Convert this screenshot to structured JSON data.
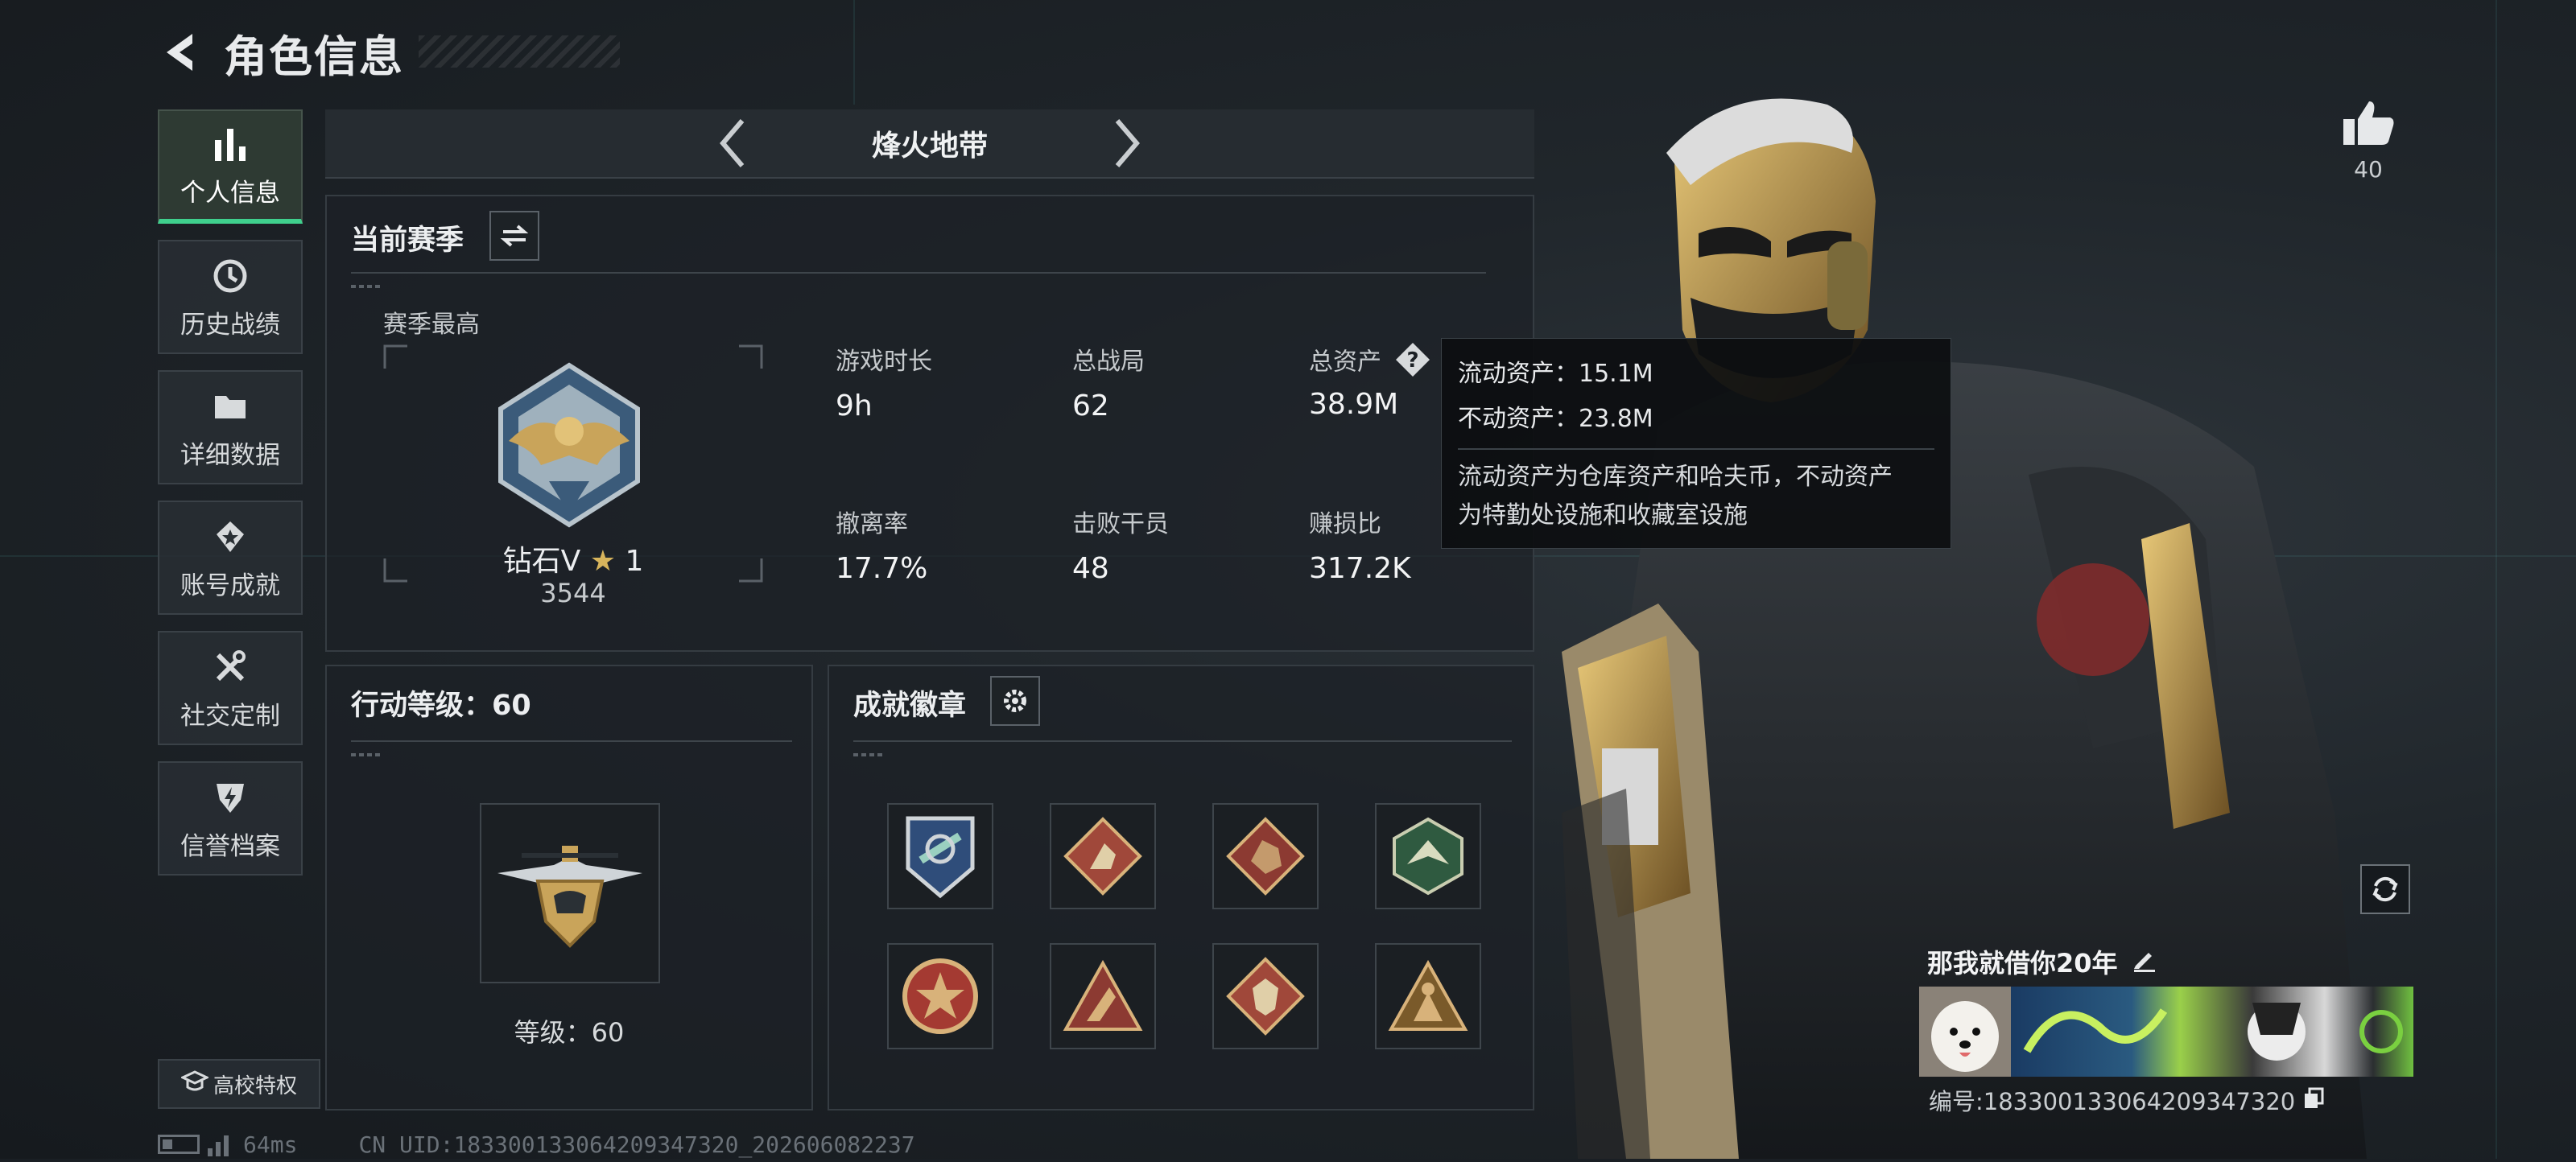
{
  "header": {
    "title": "角色信息"
  },
  "sidebar": {
    "items": [
      {
        "label": "个人信息"
      },
      {
        "label": "历史战绩"
      },
      {
        "label": "详细数据"
      },
      {
        "label": "账号成就"
      },
      {
        "label": "社交定制"
      },
      {
        "label": "信誉档案"
      }
    ],
    "campus_label": "高校特权"
  },
  "mode": {
    "name": "烽火地带"
  },
  "season": {
    "title": "当前赛季",
    "best_label": "赛季最高",
    "rank_name": "钻石V",
    "rank_stars": "1",
    "rank_score": "3544",
    "stats": [
      {
        "key": "游戏时长",
        "value": "9h"
      },
      {
        "key": "总战局",
        "value": "62"
      },
      {
        "key": "总资产",
        "value": "38.9M"
      },
      {
        "key": "撤离率",
        "value": "17.7%"
      },
      {
        "key": "击败干员",
        "value": "48"
      },
      {
        "key": "赚损比",
        "value": "317.2K"
      }
    ]
  },
  "tooltip": {
    "liquid": "流动资产：15.1M",
    "fixed": "不动资产：23.8M",
    "desc_line1": "流动资产为仓库资产和哈夫币，不动资产",
    "desc_line2": "为特勤处设施和收藏室设施"
  },
  "action_level": {
    "title": "行动等级：60",
    "level_text": "等级：60"
  },
  "achievements": {
    "title": "成就徽章"
  },
  "profile": {
    "likes": "40",
    "nickname": "那我就借你20年",
    "id_text": "编号:183300133064209347320"
  },
  "status": {
    "ping": "64ms",
    "uid": "CN UID:183300133064209347320_202606082237"
  },
  "colors": {
    "accent": "#3fd08d",
    "gold": "#c9a45a",
    "panel": "#1c2126"
  }
}
